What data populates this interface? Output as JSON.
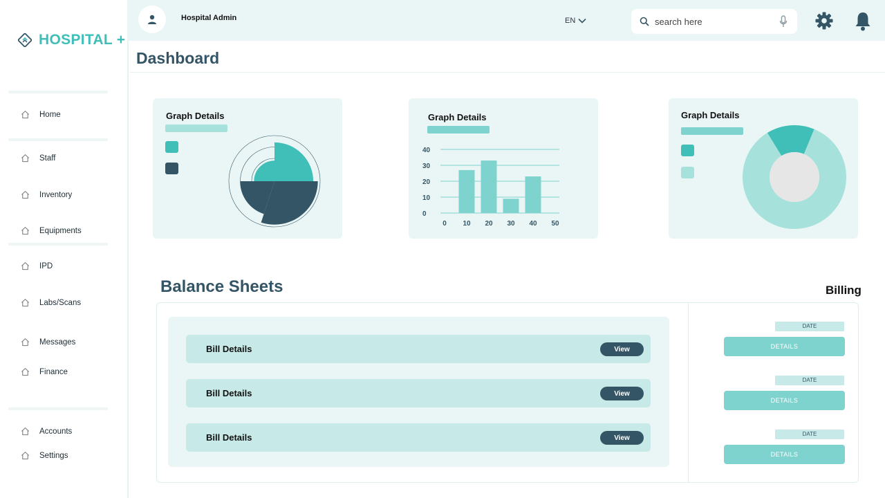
{
  "brand": {
    "name": "HOSPITAL +"
  },
  "sidebar": {
    "items": [
      {
        "label": "Home",
        "icon": "home-icon"
      },
      {
        "label": "Staff",
        "icon": "home-icon"
      },
      {
        "label": "Inventory",
        "icon": "home-icon"
      },
      {
        "label": "Equipments",
        "icon": "home-icon"
      },
      {
        "label": "IPD",
        "icon": "home-icon"
      },
      {
        "label": "Labs/Scans",
        "icon": "home-icon"
      },
      {
        "label": "Messages",
        "icon": "home-icon"
      },
      {
        "label": "Finance",
        "icon": "home-icon"
      },
      {
        "label": "Accounts",
        "icon": "home-icon"
      },
      {
        "label": "Settings",
        "icon": "home-icon"
      }
    ]
  },
  "header": {
    "user_name": "Hospital Admin",
    "language": "EN",
    "search_placeholder": "search here"
  },
  "page": {
    "title": "Dashboard"
  },
  "cards": [
    {
      "title": "Graph Details"
    },
    {
      "title": "Graph Details"
    },
    {
      "title": "Graph Details"
    }
  ],
  "colors": {
    "teal": "#3fbfb7",
    "dark": "#335566",
    "light_teal": "#a6e1dc",
    "panel": "#eaf6f5"
  },
  "chart_data": [
    {
      "type": "pie",
      "title": "Graph Details",
      "values": [
        25,
        30,
        20,
        25
      ],
      "radii": [
        0.85,
        0.95,
        0.75,
        0.45
      ],
      "colors": [
        "#3fbfb7",
        "#335566",
        "#335566",
        "#3fbfb7"
      ],
      "legend_colors": [
        "#3fbfb7",
        "#335566"
      ],
      "rings": 4
    },
    {
      "type": "bar",
      "title": "Graph Details",
      "categories": [
        "10",
        "20",
        "30",
        "40"
      ],
      "values": [
        27,
        33,
        9,
        23
      ],
      "x_ticks": [
        "0",
        "10",
        "20",
        "30",
        "40",
        "50"
      ],
      "y_ticks": [
        "0",
        "10",
        "20",
        "30",
        "40"
      ],
      "ylim": [
        0,
        40
      ],
      "color": "#7fd3ce"
    },
    {
      "type": "pie",
      "title": "Graph Details",
      "values": [
        15,
        85
      ],
      "colors": [
        "#3fbfb7",
        "#a6e1dc"
      ],
      "legend_colors": [
        "#3fbfb7",
        "#a6e1dc"
      ],
      "donut": true
    }
  ],
  "balance": {
    "title": "Balance Sheets",
    "rows": [
      {
        "label": "Bill Details",
        "button": "View"
      },
      {
        "label": "Bill Details",
        "button": "View"
      },
      {
        "label": "Bill Details",
        "button": "View"
      }
    ]
  },
  "billing": {
    "title": "Billing",
    "items": [
      {
        "date": "DATE",
        "button": "DETAILS"
      },
      {
        "date": "DATE",
        "button": "DETAILS"
      },
      {
        "date": "DATE",
        "button": "DETAILS"
      }
    ]
  }
}
